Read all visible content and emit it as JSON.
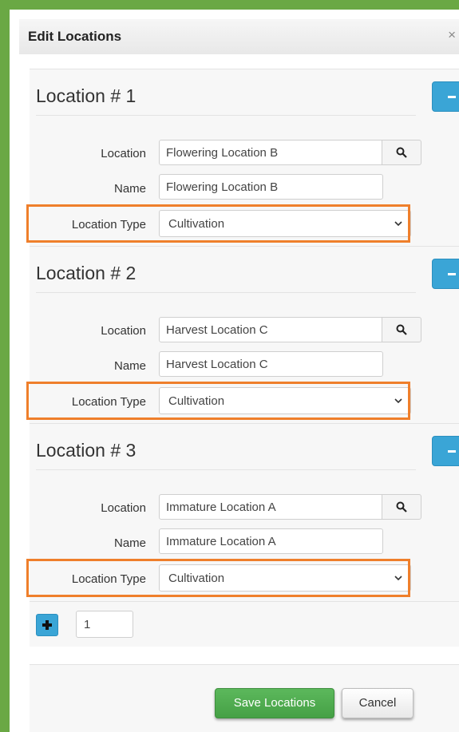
{
  "dialog": {
    "title": "Edit Locations",
    "close_symbol": "×"
  },
  "labels": {
    "location": "Location",
    "name": "Name",
    "location_type": "Location Type"
  },
  "locations": [
    {
      "heading": "Location # 1",
      "location": "Flowering Location B",
      "name": "Flowering Location B",
      "type": "Cultivation"
    },
    {
      "heading": "Location # 2",
      "location": "Harvest Location C",
      "name": "Harvest Location C",
      "type": "Cultivation"
    },
    {
      "heading": "Location # 3",
      "location": "Immature Location A",
      "name": "Immature Location A",
      "type": "Cultivation"
    }
  ],
  "add_row": {
    "count": "1"
  },
  "footer": {
    "save_label": "Save Locations",
    "cancel_label": "Cancel"
  },
  "colors": {
    "frame": "#6aa844",
    "highlight": "#ef7f2b",
    "primary_button": "#3aa5d6",
    "save_button": "#5cb85c"
  },
  "icons": {
    "search": "search-icon",
    "chevron": "chevron-down-icon",
    "remove": "minus-icon",
    "add": "plus-icon",
    "close": "close-icon"
  }
}
